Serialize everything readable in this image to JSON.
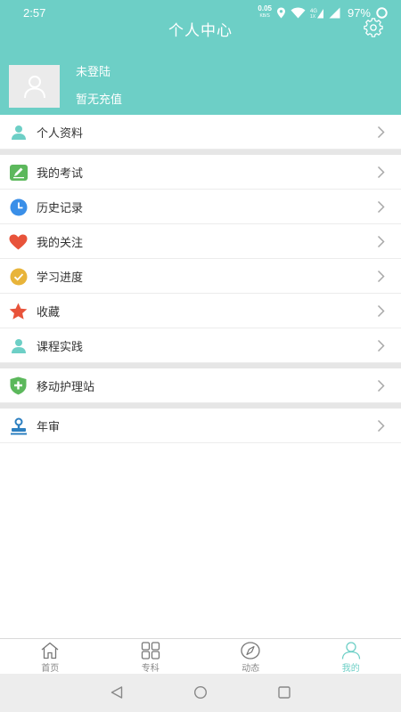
{
  "status_bar": {
    "time": "2:57",
    "net_speed": "0.05",
    "net_unit": "KB/S",
    "battery": "97%"
  },
  "header": {
    "title": "个人中心",
    "settings_icon": "gear-icon"
  },
  "profile": {
    "login_status": "未登陆",
    "recharge_status": "暂无充值"
  },
  "menu": {
    "personal_info": "个人资料",
    "my_exams": "我的考试",
    "history": "历史记录",
    "my_follows": "我的关注",
    "study_progress": "学习进度",
    "favorites": "收藏",
    "course_practice": "课程实践",
    "mobile_nursing": "移动护理站",
    "annual_review": "年审"
  },
  "tabs": {
    "home": "首页",
    "specialty": "专科",
    "news": "动态",
    "mine": "我的"
  },
  "colors": {
    "accent": "#6dcfc6",
    "heart": "#e8533a",
    "star": "#e8533a",
    "check": "#e8b43a",
    "clock": "#3a8fe8",
    "pencil": "#5cb85c",
    "shield": "#5cb85c",
    "stamp": "#2c7fc0"
  }
}
